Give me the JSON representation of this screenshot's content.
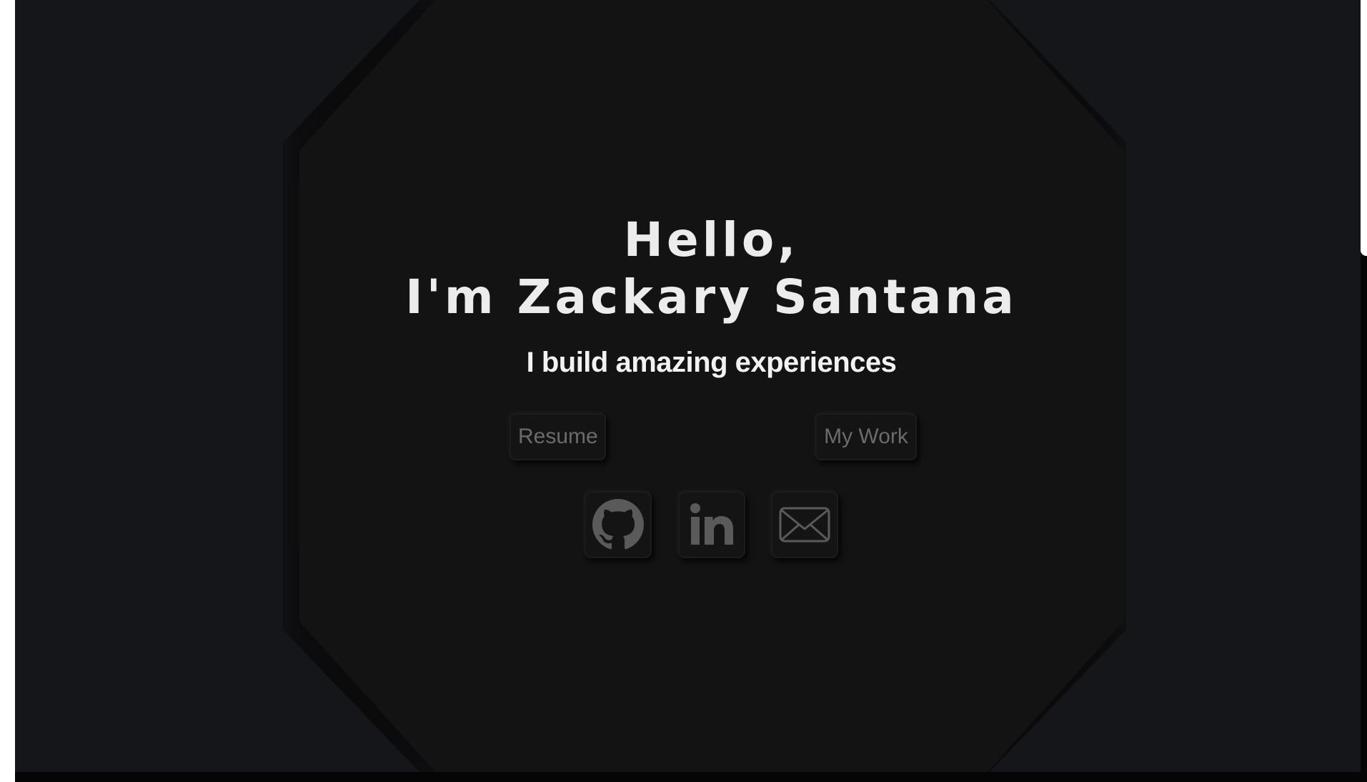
{
  "hero": {
    "greeting": "Hello,",
    "name_line": "I'm Zackary Santana",
    "tagline": "I build amazing experiences"
  },
  "buttons": {
    "resume_label": "Resume",
    "work_label": "My Work"
  },
  "social": [
    {
      "icon": "github-icon"
    },
    {
      "icon": "linkedin-icon"
    },
    {
      "icon": "email-icon"
    }
  ],
  "colors": {
    "page_background": "#15161a",
    "panel_background": "#131314",
    "heading_text": "#ececec",
    "button_text": "#6b6b6b",
    "icon_color": "#5a5a5a"
  }
}
